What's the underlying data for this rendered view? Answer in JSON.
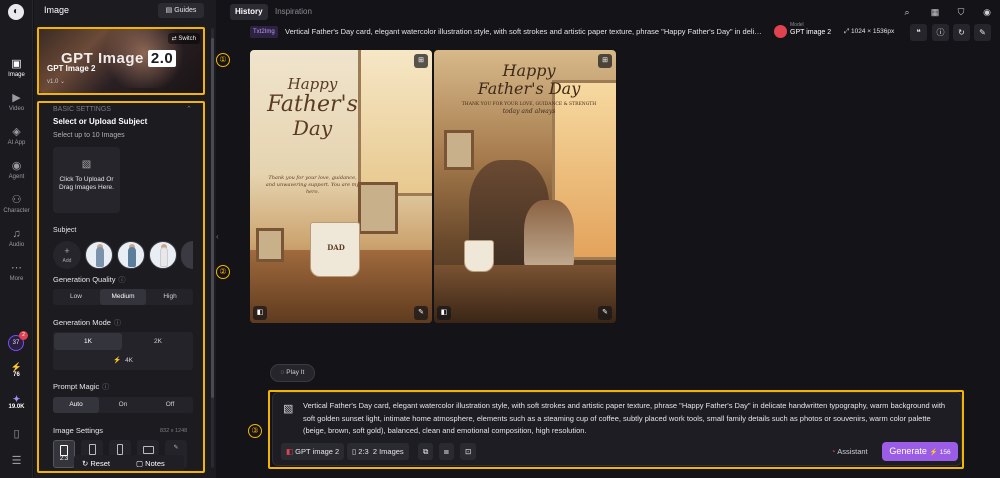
{
  "rail": {
    "items": [
      {
        "label": "Image",
        "icon": "image-icon",
        "glyph": "▣"
      },
      {
        "label": "Video",
        "icon": "video-icon",
        "glyph": "▶"
      },
      {
        "label": "AI App",
        "icon": "ai-app-icon",
        "glyph": "◈"
      },
      {
        "label": "Agent",
        "icon": "agent-icon",
        "glyph": "◉"
      },
      {
        "label": "Character",
        "icon": "character-icon",
        "glyph": "⚇"
      },
      {
        "label": "Audio",
        "icon": "audio-icon",
        "glyph": "♫"
      },
      {
        "label": "More",
        "icon": "more-icon",
        "glyph": "⋯"
      }
    ],
    "badge_value": "37",
    "badge_notice": "2",
    "stats": [
      {
        "value": "76",
        "icon": "lightning-icon",
        "glyph": "⚡"
      },
      {
        "value": "19.0K",
        "icon": "credits-icon",
        "glyph": "✦"
      }
    ]
  },
  "panel": {
    "title": "Image",
    "guides_label": "Guides",
    "model": {
      "big_title": "GPT Image",
      "big_version": "2.0",
      "name": "GPT Image 2",
      "version": "v1.0",
      "switch_label": "Switch"
    },
    "basic_settings_label": "BASIC SETTINGS",
    "upload_title": "Select or Upload Subject",
    "upload_hint": "Select up to 10 Images",
    "upload_box_text": "Click To Upload Or Drag Images Here.",
    "subject_label": "Subject",
    "subject_add_label": "Add",
    "quality_label": "Generation Quality",
    "quality_options": [
      "Low",
      "Medium",
      "High"
    ],
    "quality_selected": "Medium",
    "mode_label": "Generation Mode",
    "mode_options": [
      "1K",
      "2K",
      "4K"
    ],
    "mode_selected": "1K",
    "prompt_magic_label": "Prompt Magic",
    "prompt_magic_options": [
      "Auto",
      "On",
      "Off"
    ],
    "prompt_magic_selected": "Auto",
    "image_settings_label": "Image Settings",
    "image_settings_size": "832 x 1248",
    "ratio_selected": "2:3",
    "reset_label": "Reset",
    "notes_label": "Notes"
  },
  "annotations": [
    "①",
    "②",
    "③"
  ],
  "tabs": [
    {
      "label": "History",
      "active": true
    },
    {
      "label": "Inspiration",
      "active": false
    }
  ],
  "task": {
    "tag": "Txt2Img",
    "prompt": "Vertical Father's Day card, elegant watercolor illustration style, with soft strokes and artistic paper texture, phrase \"Happy Father's Day\" in delicate handwritten typography",
    "model_caption": "Model",
    "model_name": "GPT image 2",
    "resolution": "1024 × 1536px"
  },
  "images": [
    {
      "heading_line1": "Happy",
      "heading_line2": "Father's",
      "heading_line3": "Day",
      "body": "Thank you for your love, guidance, and unwavering support. You are my hero.",
      "mug_text": "DAD"
    },
    {
      "heading_line1": "Happy",
      "heading_line2": "Father's Day",
      "sub": "THANK YOU FOR YOUR LOVE, GUIDANCE & STRENGTH",
      "sub2": "today and always"
    }
  ],
  "play_chip_label": "Play It",
  "prompt_box": {
    "text": "Vertical Father's Day card, elegant watercolor illustration style, with soft strokes and artistic paper texture, phrase \"Happy Father's Day\" in delicate handwritten typography, warm background with soft golden sunset light, intimate home atmosphere, elements such as a steaming cup of coffee, subtly placed work tools, small family details such as photos or souvenirs, warm color palette (beige, brown, soft gold), balanced, clean and emotional composition, high resolution.",
    "model_chip": "GPT image 2",
    "ratio_chip": "2:3",
    "count_chip": "2 Images",
    "assistant_label": "Assistant",
    "generate_label": "Generate",
    "generate_cost": "156"
  },
  "colors": {
    "accent": "#9b5de5",
    "annotation": "#f5b400",
    "background": "#141418"
  }
}
